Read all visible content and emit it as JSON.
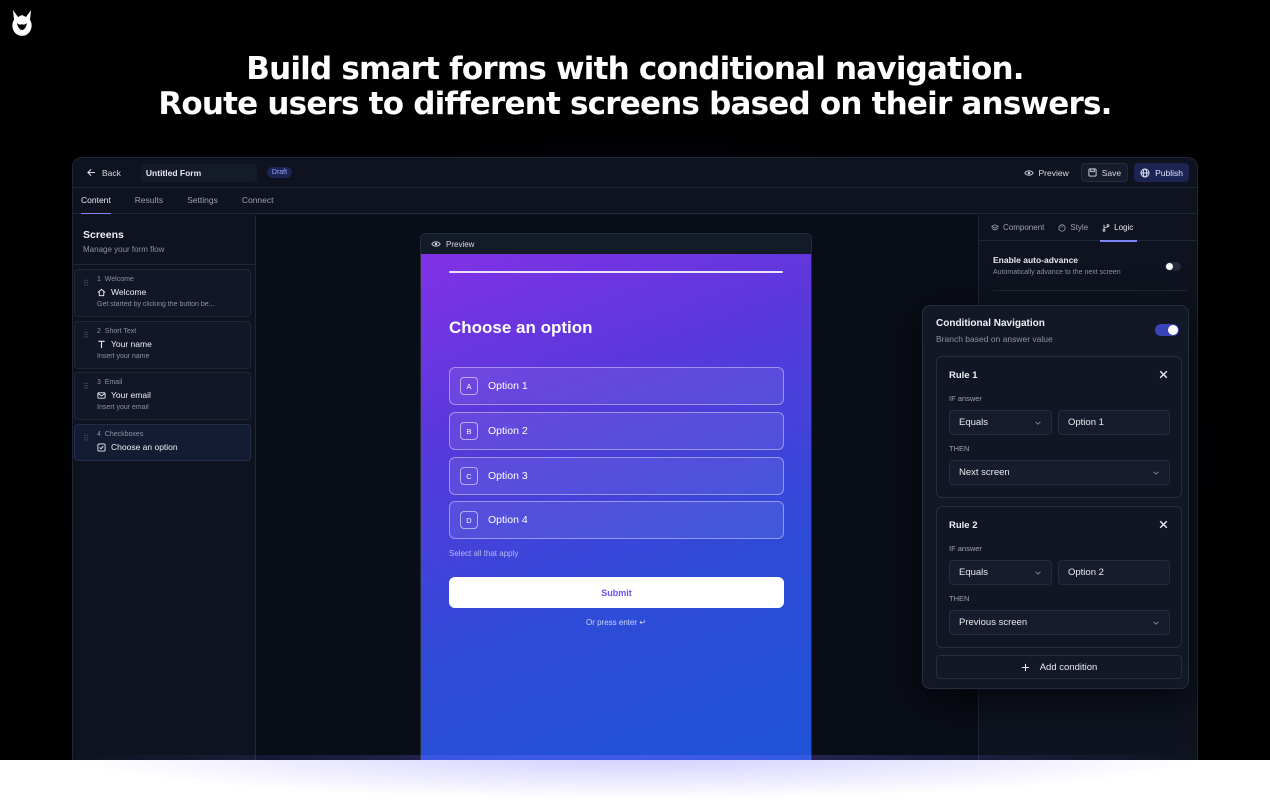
{
  "headline": {
    "line1": "Build smart forms with conditional navigation.",
    "line2": "Route users to different screens based on their answers."
  },
  "topbar": {
    "back_label": "Back",
    "form_title": "Untitled Form",
    "status_badge": "Draft",
    "preview_label": "Preview",
    "save_label": "Save",
    "publish_label": "Publish"
  },
  "tabs": [
    {
      "label": "Content",
      "active": true
    },
    {
      "label": "Results",
      "active": false
    },
    {
      "label": "Settings",
      "active": false
    },
    {
      "label": "Connect",
      "active": false
    }
  ],
  "screens": {
    "title": "Screens",
    "subtitle": "Manage your form flow",
    "items": [
      {
        "number": "1",
        "type": "Welcome",
        "name": "Welcome",
        "icon": "home-icon",
        "description": "Get started by clicking the button be..."
      },
      {
        "number": "2",
        "type": "Short Text",
        "name": "Your name",
        "icon": "text-icon",
        "description": "Insert your name"
      },
      {
        "number": "3",
        "type": "Email",
        "name": "Your email",
        "icon": "mail-icon",
        "description": "Insert your email"
      },
      {
        "number": "4",
        "type": "Checkboxes",
        "name": "Choose an option",
        "icon": "checkbox-icon",
        "description": ""
      }
    ]
  },
  "preview": {
    "header_label": "Preview",
    "question": "Choose an option",
    "options": [
      {
        "key": "A",
        "label": "Option 1"
      },
      {
        "key": "B",
        "label": "Option 2"
      },
      {
        "key": "C",
        "label": "Option 3"
      },
      {
        "key": "D",
        "label": "Option 4"
      }
    ],
    "hint": "Select all that apply",
    "submit_label": "Submit",
    "press_enter": "Or press enter ↵",
    "gradient": [
      "#8232e6",
      "#1f53d8"
    ]
  },
  "right_panel": {
    "tabs": [
      {
        "label": "Component",
        "icon": "layers-icon",
        "active": false
      },
      {
        "label": "Style",
        "icon": "palette-icon",
        "active": false
      },
      {
        "label": "Logic",
        "icon": "branch-icon",
        "active": true
      }
    ],
    "auto_advance": {
      "title": "Enable auto-advance",
      "subtitle": "Automatically advance to the next screen",
      "enabled": false
    }
  },
  "conditional": {
    "title": "Conditional Navigation",
    "subtitle": "Branch based on answer value",
    "enabled": true,
    "if_label": "IF answer",
    "then_label": "THEN",
    "rules": [
      {
        "title": "Rule 1",
        "operator": "Equals",
        "value": "Option 1",
        "action": "Next screen"
      },
      {
        "title": "Rule 2",
        "operator": "Equals",
        "value": "Option 2",
        "action": "Previous screen"
      }
    ],
    "add_label": "Add condition"
  },
  "colors": {
    "accent": "#7e86ff",
    "publish_bg": "#1c2452",
    "app_bg": "#0e131f",
    "toggle_on": "#3a44b8"
  }
}
